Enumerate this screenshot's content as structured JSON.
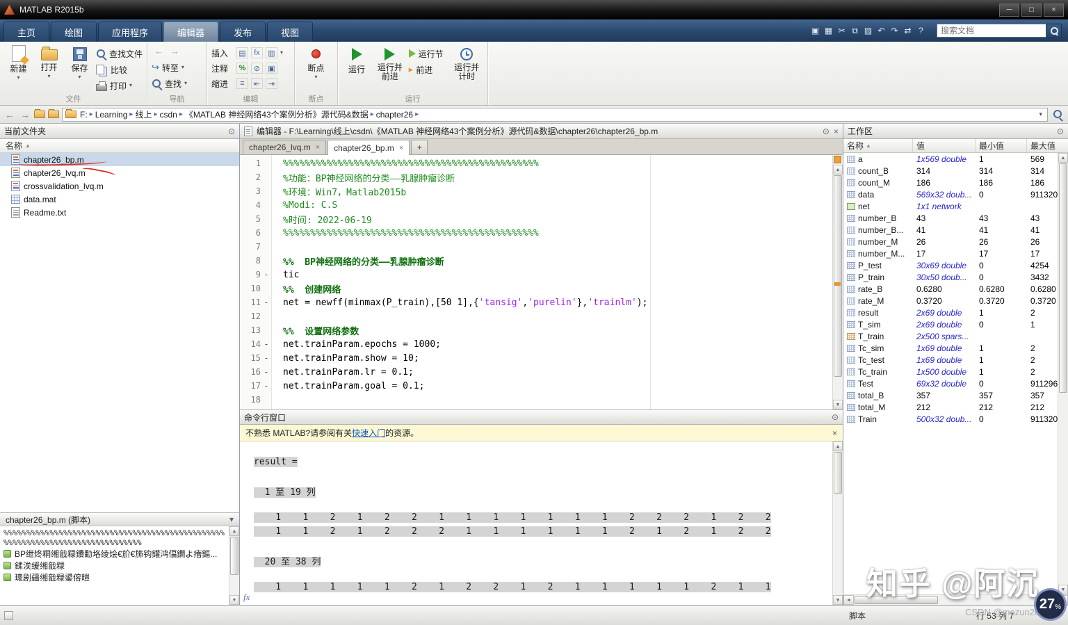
{
  "window": {
    "title": "MATLAB R2015b"
  },
  "glyphs": {
    "min": "─",
    "max": "□",
    "close": "×",
    "panel_menu": "⊙",
    "caret_down": "▾",
    "crumb_sep": "▸",
    "sort": "▲",
    "up": "▲",
    "down": "▼",
    "left": "◄",
    "right": "►",
    "plus": "+",
    "back": "←",
    "fwd": "→",
    "goto_arrow": "↪",
    "advance": "▸"
  },
  "ribbon": {
    "tabs": [
      {
        "label": "主页",
        "cls": ""
      },
      {
        "label": "绘图",
        "cls": ""
      },
      {
        "label": "应用程序",
        "cls": ""
      },
      {
        "label": "编辑器",
        "cls": "active"
      },
      {
        "label": "发布",
        "cls": ""
      },
      {
        "label": "视图",
        "cls": ""
      }
    ],
    "quick_icons": [
      {
        "name": "community-icon",
        "glyph": "▣"
      },
      {
        "name": "save-quick-icon",
        "glyph": "▦"
      },
      {
        "name": "cut-icon",
        "glyph": "✂"
      },
      {
        "name": "copy-icon",
        "glyph": "⧉"
      },
      {
        "name": "paste-icon",
        "glyph": "▨"
      },
      {
        "name": "undo-icon",
        "glyph": "↶"
      },
      {
        "name": "redo-icon",
        "glyph": "↷"
      },
      {
        "name": "switch-window-icon",
        "glyph": "⇄"
      },
      {
        "name": "help-icon",
        "glyph": "?"
      }
    ],
    "search_placeholder": "搜索文档"
  },
  "toolbar": {
    "file_group": {
      "label": "文件",
      "new": "新建",
      "open": "打开",
      "save": "保存",
      "find_files": "查找文件",
      "compare": "比较",
      "print": "打印"
    },
    "nav_group": {
      "label": "导航",
      "goto": "转至",
      "find": "查找"
    },
    "edit_group": {
      "label": "编辑",
      "insert": "插入",
      "comment": "注释",
      "indent": "缩进",
      "icons": {
        "section": "▤",
        "fx": "fx",
        "var": "▥",
        "comment": "%",
        "uncomment": "⊘",
        "wrap": "▣",
        "indent_r": "⇥",
        "indent_l": "⇤",
        "smart": "≡"
      }
    },
    "break_group": {
      "label": "断点",
      "breakpoints": "断点"
    },
    "run_group": {
      "label": "运行",
      "run": "运行",
      "run_advance_1": "运行并",
      "run_advance_2": "前进",
      "run_section": "运行节",
      "advance": "前进",
      "run_time_1": "运行并",
      "run_time_2": "计时"
    }
  },
  "addressbar": {
    "segments": [
      "F:",
      "Learning",
      "线上",
      "csdn",
      "《MATLAB 神经网络43个案例分析》源代码&数据",
      "chapter26"
    ]
  },
  "current_folder": {
    "title": "当前文件夹",
    "name_col": "名称",
    "files": [
      {
        "name": "chapter26_bp.m",
        "icon": "fi-m",
        "icon_name": "m-file-icon",
        "selected": "sel",
        "anno": "underline"
      },
      {
        "name": "chapter26_lvq.m",
        "icon": "fi-m",
        "icon_name": "m-file-icon",
        "selected": "",
        "anno": "strike"
      },
      {
        "name": "crossvalidation_lvq.m",
        "icon": "fi-m",
        "icon_name": "m-file-icon",
        "selected": "",
        "anno": ""
      },
      {
        "name": "data.mat",
        "icon": "fi-mat",
        "icon_name": "mat-file-icon",
        "selected": "",
        "anno": ""
      },
      {
        "name": "Readme.txt",
        "icon": "fi-txt",
        "icon_name": "txt-file-icon",
        "selected": "",
        "anno": ""
      }
    ],
    "preview": {
      "title": "chapter26_bp.m  (脚本)",
      "comment_line": "%%%%%%%%%%%%%%%%%%%%%%%%%%%%%%%%%%%%%%%%%%%%%%%%%%%%%%%%%%%%%%%%%%%%%%%%%%%%%%",
      "sections": [
        {
          "text": "BP绁炵粡缃戠粶鐨勫垎绫烩€斺€斾钩鑵鸿偪鐦よ瘖鏂..."
        },
        {
          "text": "鍒涘缓缃戠粶"
        },
        {
          "text": "璁剧疆缃戠粶鍙傛暟"
        }
      ]
    }
  },
  "editor": {
    "title": "编辑器 - F:\\Learning\\线上\\csdn\\《MATLAB 神经网络43个案例分析》源代码&数据\\chapter26\\chapter26_bp.m",
    "tabs": [
      {
        "label": "chapter26_lvq.m",
        "cls": ""
      },
      {
        "label": "chapter26_bp.m",
        "cls": "active"
      }
    ],
    "code_lines": [
      {
        "n": "1",
        "d": "",
        "parts": [
          {
            "t": "%%%%%%%%%%%%%%%%%%%%%%%%%%%%%%%%%%%%%%%%%%%%%%%",
            "c": "cmt"
          }
        ]
      },
      {
        "n": "2",
        "d": "",
        "parts": [
          {
            "t": "%功能：BP神经网络的分类——乳腺肿瘤诊断",
            "c": "cmt"
          }
        ]
      },
      {
        "n": "3",
        "d": "",
        "parts": [
          {
            "t": "%环境：Win7，Matlab2015b",
            "c": "cmt"
          }
        ]
      },
      {
        "n": "4",
        "d": "",
        "parts": [
          {
            "t": "%Modi: C.S",
            "c": "cmt"
          }
        ]
      },
      {
        "n": "5",
        "d": "",
        "parts": [
          {
            "t": "%时间: 2022-06-19",
            "c": "cmt"
          }
        ]
      },
      {
        "n": "6",
        "d": "",
        "parts": [
          {
            "t": "%%%%%%%%%%%%%%%%%%%%%%%%%%%%%%%%%%%%%%%%%%%%%%%",
            "c": "cmt"
          }
        ]
      },
      {
        "n": "7",
        "d": "",
        "parts": []
      },
      {
        "n": "8",
        "d": "",
        "parts": [
          {
            "t": "%%  BP神经网络的分类——乳腺肿瘤诊断",
            "c": "sec"
          }
        ]
      },
      {
        "n": "9",
        "d": "-",
        "parts": [
          {
            "t": "tic",
            "c": "code"
          }
        ]
      },
      {
        "n": "10",
        "d": "",
        "parts": [
          {
            "t": "%%  创建网络",
            "c": "sec"
          }
        ]
      },
      {
        "n": "11",
        "d": "-",
        "parts": [
          {
            "t": "net = newff(minmax(P_train),[50 1],{",
            "c": "code"
          },
          {
            "t": "'tansig'",
            "c": "str"
          },
          {
            "t": ",",
            "c": "code"
          },
          {
            "t": "'purelin'",
            "c": "str"
          },
          {
            "t": "},",
            "c": "code"
          },
          {
            "t": "'trainlm'",
            "c": "str"
          },
          {
            "t": ");",
            "c": "code"
          }
        ]
      },
      {
        "n": "12",
        "d": "",
        "parts": []
      },
      {
        "n": "13",
        "d": "",
        "parts": [
          {
            "t": "%%  设置网络参数",
            "c": "sec"
          }
        ]
      },
      {
        "n": "14",
        "d": "-",
        "parts": [
          {
            "t": "net.trainParam.epochs = 1000;",
            "c": "code"
          }
        ]
      },
      {
        "n": "15",
        "d": "-",
        "parts": [
          {
            "t": "net.trainParam.show = 10;",
            "c": "code"
          }
        ]
      },
      {
        "n": "16",
        "d": "-",
        "parts": [
          {
            "t": "net.trainParam.lr = 0.1;",
            "c": "code"
          }
        ]
      },
      {
        "n": "17",
        "d": "-",
        "parts": [
          {
            "t": "net.trainParam.goal = 0.1;",
            "c": "code"
          }
        ]
      },
      {
        "n": "18",
        "d": "",
        "parts": []
      }
    ]
  },
  "cmd": {
    "title": "命令行窗口",
    "banner": {
      "prefix": "不熟悉 MATLAB?请参阅有关",
      "link": "快速入门",
      "suffix": "的资源。"
    },
    "fx_label": "fx",
    "lines": [
      {
        "t": "result =",
        "c": "sel"
      },
      {
        "t": "",
        "c": ""
      },
      {
        "t": "  1 至 19 列",
        "c": "sel"
      },
      {
        "t": "",
        "c": ""
      },
      {
        "t": "    1    1    2    1    2    2    1    1    1    1    1    1    1    2    2    2    1    2    2",
        "c": "sel"
      },
      {
        "t": "    1    1    2    1    2    2    2    1    1    1    1    1    1    2    1    2    1    2    2",
        "c": "sel"
      },
      {
        "t": "",
        "c": ""
      },
      {
        "t": "  20 至 38 列",
        "c": "sel"
      },
      {
        "t": "",
        "c": ""
      },
      {
        "t": "    1    1    1    1    1    2    1    2    2    1    2    1    1    1    1    1    2    1    1",
        "c": "sel"
      }
    ]
  },
  "workspace": {
    "title": "工作区",
    "cols": [
      "名称",
      "值",
      "最小值",
      "最大值"
    ],
    "rows": [
      {
        "name": "a",
        "icon": "",
        "icon_name": "matrix-icon",
        "value": "1x569 double",
        "vc": "dim",
        "min": "1",
        "max": "569"
      },
      {
        "name": "count_B",
        "icon": "",
        "icon_name": "matrix-icon",
        "value": "314",
        "vc": "num",
        "min": "314",
        "max": "314"
      },
      {
        "name": "count_M",
        "icon": "",
        "icon_name": "matrix-icon",
        "value": "186",
        "vc": "num",
        "min": "186",
        "max": "186"
      },
      {
        "name": "data",
        "icon": "",
        "icon_name": "matrix-icon",
        "value": "569x32 doub...",
        "vc": "dim",
        "min": "0",
        "max": "911320..."
      },
      {
        "name": "net",
        "icon": "net",
        "icon_name": "network-object-icon",
        "value": "1x1 network",
        "vc": "dim",
        "min": "",
        "max": ""
      },
      {
        "name": "number_B",
        "icon": "",
        "icon_name": "matrix-icon",
        "value": "43",
        "vc": "num",
        "min": "43",
        "max": "43"
      },
      {
        "name": "number_B...",
        "icon": "",
        "icon_name": "matrix-icon",
        "value": "41",
        "vc": "num",
        "min": "41",
        "max": "41"
      },
      {
        "name": "number_M",
        "icon": "",
        "icon_name": "matrix-icon",
        "value": "26",
        "vc": "num",
        "min": "26",
        "max": "26"
      },
      {
        "name": "number_M...",
        "icon": "",
        "icon_name": "matrix-icon",
        "value": "17",
        "vc": "num",
        "min": "17",
        "max": "17"
      },
      {
        "name": "P_test",
        "icon": "",
        "icon_name": "matrix-icon",
        "value": "30x69 double",
        "vc": "dim",
        "min": "0",
        "max": "4254"
      },
      {
        "name": "P_train",
        "icon": "",
        "icon_name": "matrix-icon",
        "value": "30x50 doub...",
        "vc": "dim",
        "min": "0",
        "max": "3432"
      },
      {
        "name": "rate_B",
        "icon": "",
        "icon_name": "matrix-icon",
        "value": "0.6280",
        "vc": "num",
        "min": "0.6280",
        "max": "0.6280"
      },
      {
        "name": "rate_M",
        "icon": "",
        "icon_name": "matrix-icon",
        "value": "0.3720",
        "vc": "num",
        "min": "0.3720",
        "max": "0.3720"
      },
      {
        "name": "result",
        "icon": "",
        "icon_name": "matrix-icon",
        "value": "2x69 double",
        "vc": "dim",
        "min": "1",
        "max": "2"
      },
      {
        "name": "T_sim",
        "icon": "",
        "icon_name": "matrix-icon",
        "value": "2x69 double",
        "vc": "dim",
        "min": "0",
        "max": "1"
      },
      {
        "name": "T_train",
        "icon": "sparse",
        "icon_name": "sparse-matrix-icon",
        "value": "2x500 spars...",
        "vc": "dim",
        "min": "",
        "max": ""
      },
      {
        "name": "Tc_sim",
        "icon": "",
        "icon_name": "matrix-icon",
        "value": "1x69 double",
        "vc": "dim",
        "min": "1",
        "max": "2"
      },
      {
        "name": "Tc_test",
        "icon": "",
        "icon_name": "matrix-icon",
        "value": "1x69 double",
        "vc": "dim",
        "min": "1",
        "max": "2"
      },
      {
        "name": "Tc_train",
        "icon": "",
        "icon_name": "matrix-icon",
        "value": "1x500 double",
        "vc": "dim",
        "min": "1",
        "max": "2"
      },
      {
        "name": "Test",
        "icon": "",
        "icon_name": "matrix-icon",
        "value": "69x32 double",
        "vc": "dim",
        "min": "0",
        "max": "911296..."
      },
      {
        "name": "total_B",
        "icon": "",
        "icon_name": "matrix-icon",
        "value": "357",
        "vc": "num",
        "min": "357",
        "max": "357"
      },
      {
        "name": "total_M",
        "icon": "",
        "icon_name": "matrix-icon",
        "value": "212",
        "vc": "num",
        "min": "212",
        "max": "212"
      },
      {
        "name": "Train",
        "icon": "",
        "icon_name": "matrix-icon",
        "value": "500x32 doub...",
        "vc": "dim",
        "min": "0",
        "max": "911320..."
      }
    ]
  },
  "statusbar": {
    "script_label": "脚本",
    "position": "行 53  列 7"
  },
  "watermark": {
    "main": "知乎 @阿沉",
    "sub": "CSDN @mozun2020",
    "badge_num": "27",
    "badge_pct": "%"
  }
}
